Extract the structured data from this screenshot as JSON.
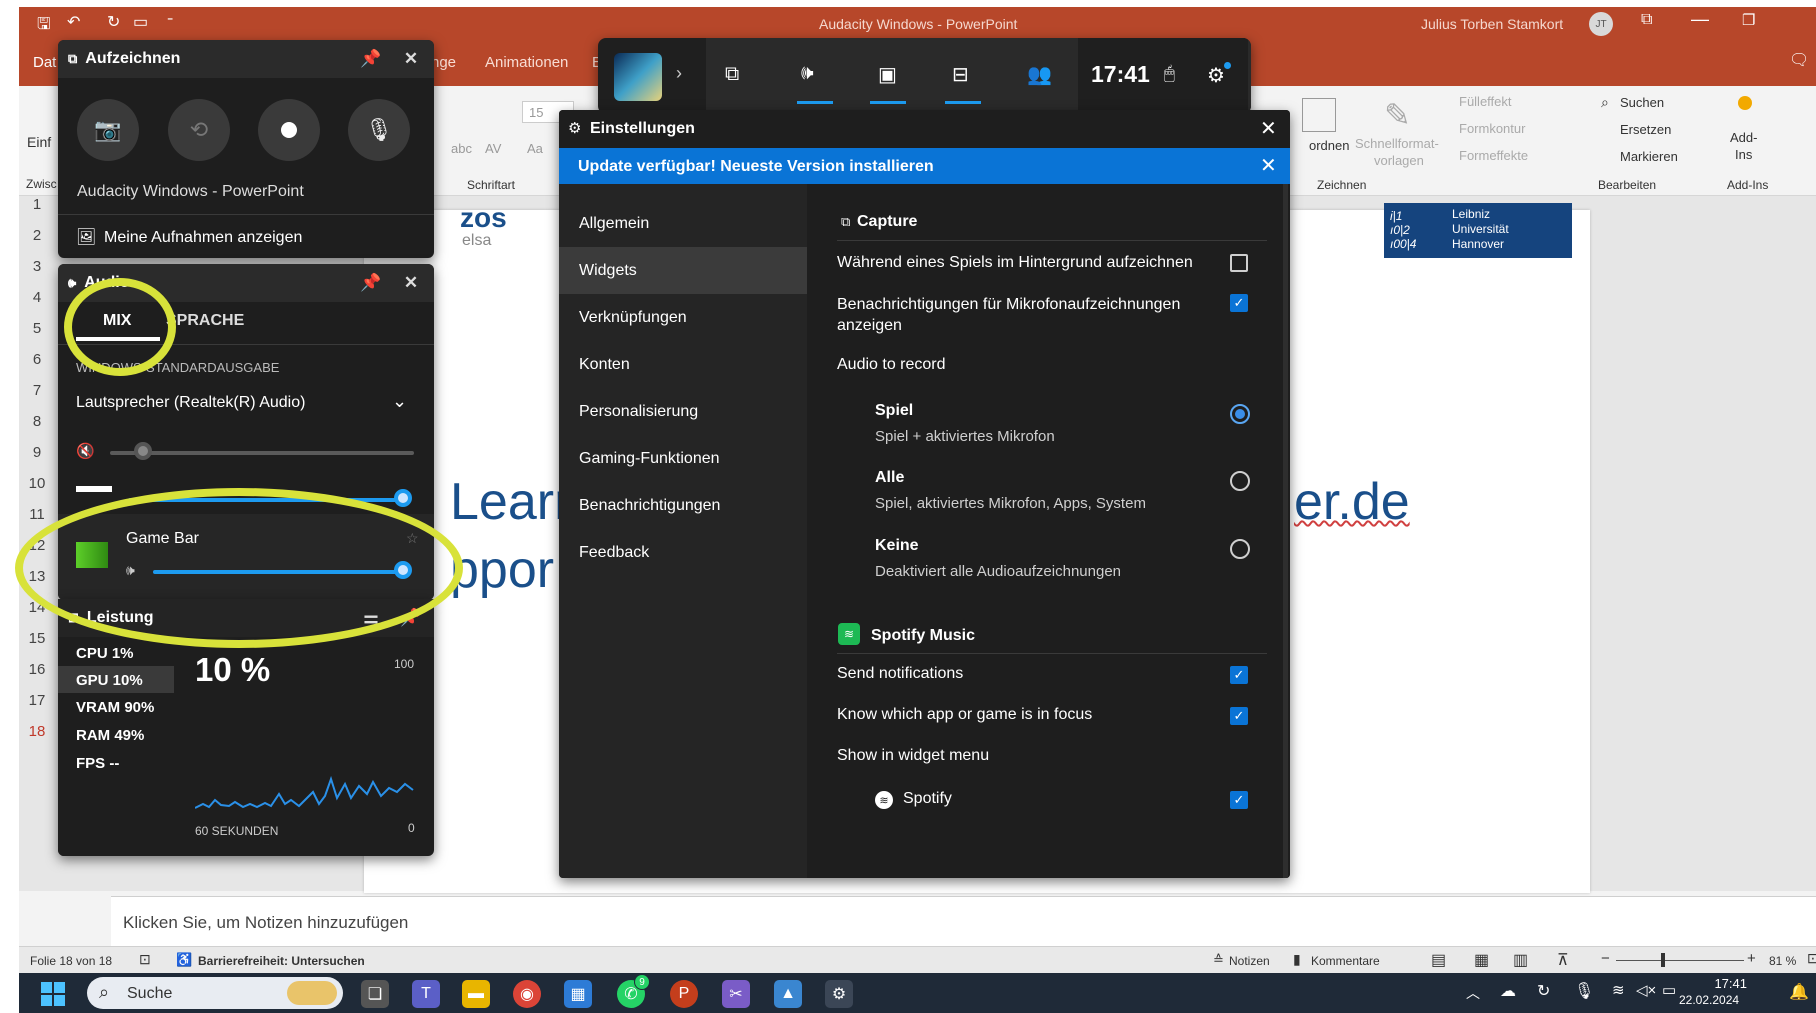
{
  "ppt": {
    "window_title": "Audacity Windows - PowerPoint",
    "user_name": "Julius Torben Stamkort",
    "user_initials": "JT",
    "tabs": [
      "Dat",
      "nge",
      "Animationen",
      "E"
    ],
    "font_size": "15",
    "group_labels": {
      "font": "Schriftart",
      "clip": "Zwisc",
      "draw": "Zeichnen",
      "edit": "Bearbeiten",
      "addins": "Add-Ins"
    },
    "insert_label": "Einf",
    "ribbon": {
      "fill": "Fülleffekt",
      "contour": "Formkontur",
      "effects": "Formeffekte",
      "arrange": "ordnen",
      "quick_styles_1": "Schnellformat-",
      "quick_styles_2": "vorlagen",
      "search": "Suchen",
      "replace": "Ersetzen",
      "select": "Markieren",
      "addins_1": "Add-",
      "addins_2": "Ins"
    },
    "slide_numbers": [
      "1",
      "2",
      "3",
      "4",
      "5",
      "6",
      "7",
      "8",
      "9",
      "10",
      "11",
      "12",
      "13",
      "14",
      "15",
      "16",
      "17",
      "18"
    ],
    "slide": {
      "logo_zos": "zos",
      "logo_elsa": "elsa",
      "heading_part1": "Learn",
      "heading_part2": "er.de",
      "heading_line2": "ppor",
      "uni_logo_line1": "Leibniz",
      "uni_logo_line2": "Universität",
      "uni_logo_line3": "Hannover"
    },
    "notes_placeholder": "Klicken Sie, um Notizen hinzuzufügen",
    "status": {
      "slide_info": "Folie 18 von 18",
      "accessibility": "Barrierefreiheit: Untersuchen",
      "notes": "Notizen",
      "comments": "Kommentare",
      "zoom": "81 %"
    }
  },
  "taskbar": {
    "search_placeholder": "Suche",
    "time": "17:41",
    "date": "22.02.2024",
    "whatsapp_badge": "9"
  },
  "gamebar_top": {
    "clock": "17:41"
  },
  "capture_widget": {
    "title": "Aufzeichnen",
    "app_name": "Audacity Windows - PowerPoint",
    "show_recordings": "Meine Aufnahmen anzeigen"
  },
  "audio_widget": {
    "title": "Audio",
    "tab_mix": "MIX",
    "tab_voice": "SPRACHE",
    "output_label": "WINDOWS-STANDARDAUSGABE",
    "device": "Lautsprecher (Realtek(R) Audio)",
    "master_volume": 0.11,
    "app_volume": 1.0,
    "gamebar_label": "Game Bar",
    "gamebar_volume": 1.0
  },
  "perf_widget": {
    "title": "Leistung",
    "cpu": "CPU  1%",
    "gpu": "GPU  10%",
    "vram": "VRAM  90%",
    "ram": "RAM  49%",
    "fps": "FPS  --",
    "big_value": "10 %",
    "max": "100",
    "min": "0",
    "duration": "60 SEKUNDEN"
  },
  "settings": {
    "title": "Einstellungen",
    "update_banner": "Update verfügbar! Neueste Version installieren",
    "nav": [
      "Allgemein",
      "Widgets",
      "Verknüpfungen",
      "Konten",
      "Personalisierung",
      "Gaming-Funktionen",
      "Benachrichtigungen",
      "Feedback"
    ],
    "selected_nav": "Widgets",
    "capture_header": "Capture",
    "bg_record": "Während eines Spiels im Hintergrund aufzeichnen",
    "mic_notify": "Benachrichtigungen für Mikrofonaufzeichnungen anzeigen",
    "audio_to_record": "Audio to record",
    "opt_game": "Spiel",
    "opt_game_sub": "Spiel + aktiviertes Mikrofon",
    "opt_all": "Alle",
    "opt_all_sub": "Spiel, aktiviertes Mikrofon, Apps, System",
    "opt_none": "Keine",
    "opt_none_sub": "Deaktiviert alle Audioaufzeichnungen",
    "spotify_header": "Spotify Music",
    "send_notifications": "Send notifications",
    "know_focus": "Know which app or game is in focus",
    "show_widget_menu": "Show in widget menu",
    "spotify": "Spotify"
  },
  "colors": {
    "ppt_accent": "#b7472a",
    "gamebar_blue": "#1d9bf0",
    "highlight": "#d8e23a",
    "banner": "#0a74d6"
  }
}
